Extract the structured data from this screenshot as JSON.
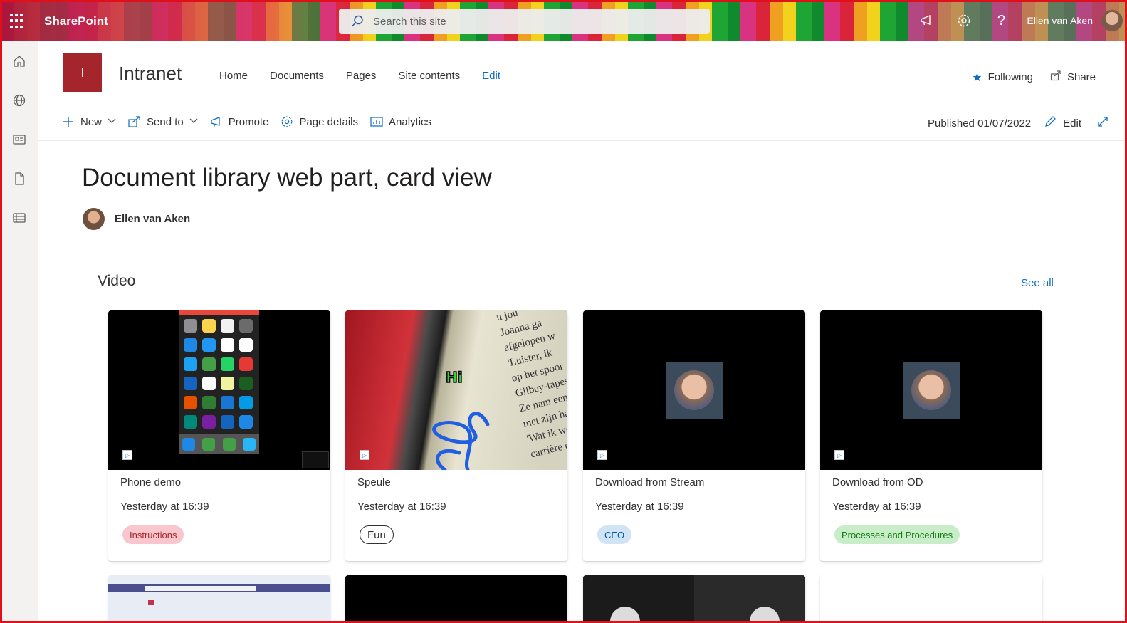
{
  "suite": {
    "app_name": "SharePoint",
    "search_placeholder": "Search this site",
    "user_name": "Ellen van Aken"
  },
  "site": {
    "logo_letter": "I",
    "title": "Intranet",
    "nav": [
      "Home",
      "Documents",
      "Pages",
      "Site contents",
      "Edit"
    ],
    "following_label": "Following",
    "share_label": "Share"
  },
  "commandbar": {
    "new_label": "New",
    "send_to_label": "Send to",
    "promote_label": "Promote",
    "page_details_label": "Page details",
    "analytics_label": "Analytics",
    "published_text": "Published 01/07/2022",
    "edit_label": "Edit"
  },
  "page": {
    "title": "Document library web part, card view",
    "author": "Ellen van Aken"
  },
  "section": {
    "title": "Video",
    "see_all": "See all"
  },
  "cards": [
    {
      "title": "Phone demo",
      "date": "Yesterday at 16:39",
      "tag": "Instructions",
      "tag_color": "#f8c6cc"
    },
    {
      "title": "Speule",
      "date": "Yesterday at 16:39",
      "tag": "Fun",
      "tag_color": "#ffffff",
      "overlay_text": "Hi"
    },
    {
      "title": "Download from Stream",
      "date": "Yesterday at 16:39",
      "tag": "CEO",
      "tag_color": "#d0e4f5"
    },
    {
      "title": "Download from OD",
      "date": "Yesterday at 16:39",
      "tag": "Processes and Procedures",
      "tag_color": "#c9ecc9"
    }
  ],
  "book_text": [
    "u jou",
    "Joanna ga",
    "afgelopen w",
    "'Luister, ik",
    "op het spoor",
    "Gilbey-tapes,",
    "Ze nam een",
    "met zijn hande",
    "'Wat ik wel g",
    "carrière en stu"
  ],
  "colors": {
    "accent": "#0f6cbd",
    "site_logo": "#a4262c",
    "frame": "#e0101b"
  }
}
